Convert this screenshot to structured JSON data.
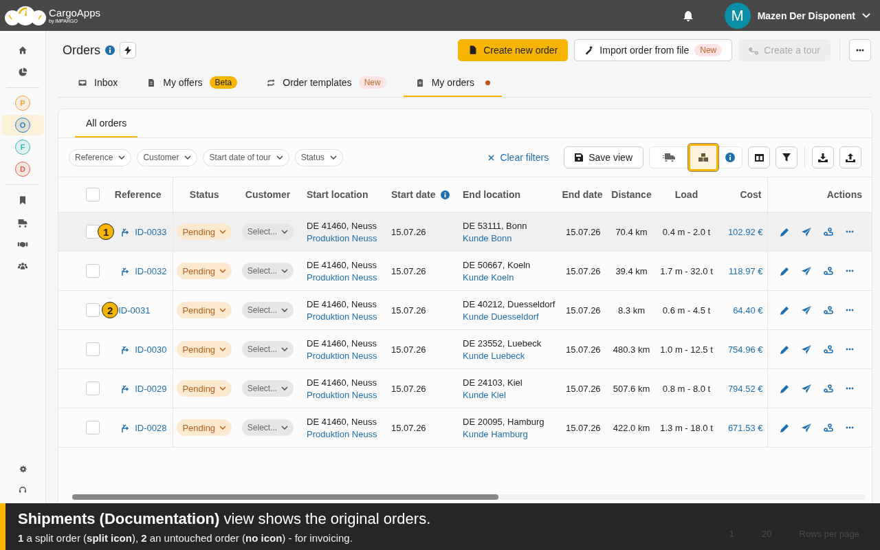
{
  "app": {
    "name": "CargoApps",
    "byline": "by IMPARGO"
  },
  "user": {
    "initial": "M",
    "name": "Mazen Der Disponent"
  },
  "sidebar": {
    "top": [
      {
        "kind": "home"
      },
      {
        "kind": "pie"
      }
    ],
    "letters": [
      {
        "letter": "P",
        "color": "#f0a53a",
        "selected": false
      },
      {
        "letter": "O",
        "color": "#2f80c0",
        "selected": true
      },
      {
        "letter": "F",
        "color": "#35b8b8",
        "selected": false
      },
      {
        "letter": "D",
        "color": "#e0674a",
        "selected": false
      }
    ],
    "middle": [
      {
        "kind": "bookmark"
      },
      {
        "kind": "truck"
      },
      {
        "kind": "handshake"
      },
      {
        "kind": "people"
      }
    ],
    "bottom": [
      {
        "kind": "gear"
      },
      {
        "kind": "headset"
      }
    ]
  },
  "page": {
    "title": "Orders"
  },
  "actions": [
    {
      "label": "Create new order",
      "kind": "primary",
      "disabled": false
    },
    {
      "label": "Import order from file",
      "kind": "import",
      "badge": "New",
      "disabled": false
    },
    {
      "label": "Create a tour",
      "kind": "tour",
      "disabled": true
    }
  ],
  "tabs": [
    {
      "label": "Inbox",
      "kind": "inbox",
      "selected": false
    },
    {
      "label": "My offers",
      "kind": "offers",
      "badge": "Beta",
      "selected": false
    },
    {
      "label": "Order templates",
      "kind": "templates",
      "badge": "New",
      "selected": false
    },
    {
      "label": "My orders",
      "kind": "orders",
      "dot": true,
      "selected": true
    }
  ],
  "subtabs": [
    {
      "label": "All orders",
      "selected": true
    }
  ],
  "filters": [
    "Reference",
    "Customer",
    "Start date of tour",
    "Status"
  ],
  "toolbar": {
    "clear": "Clear filters",
    "save": "Save view",
    "views": [
      {
        "kind": "truck",
        "selected": false
      },
      {
        "kind": "boxes",
        "selected": true
      }
    ]
  },
  "table": {
    "select_all_checked": false,
    "columns": [
      "Reference",
      "Status",
      "Customer",
      "Start location",
      "Start date",
      "End location",
      "End date",
      "Distance",
      "Load",
      "Cost",
      "Actions"
    ],
    "rows": [
      {
        "marker": "1",
        "split": true,
        "highlighted": true,
        "reference": "ID-0033",
        "status": "Pending",
        "customer": "Select...",
        "start": "DE 41460, Neuss",
        "start_site": "Produktion Neuss",
        "start_date": "15.07.26",
        "end": "DE 53111, Bonn",
        "end_site": "Kunde Bonn",
        "end_date": "15.07.26",
        "distance": "70.4 km",
        "load": "0.4 m - 2.0 t",
        "cost": "102.92 €"
      },
      {
        "split": true,
        "highlighted": false,
        "reference": "ID-0032",
        "status": "Pending",
        "customer": "Select...",
        "start": "DE 41460, Neuss",
        "start_site": "Produktion Neuss",
        "start_date": "15.07.26",
        "end": "DE 50667, Koeln",
        "end_site": "Kunde Koeln",
        "end_date": "15.07.26",
        "distance": "39.4 km",
        "load": "1.7 m - 32.0 t",
        "cost": "118.97 €"
      },
      {
        "marker": "2",
        "split": false,
        "highlighted": false,
        "reference": "ID-0031",
        "status": "Pending",
        "customer": "Select...",
        "start": "DE 41460, Neuss",
        "start_site": "Produktion Neuss",
        "start_date": "15.07.26",
        "end": "DE 40212, Duesseldorf",
        "end_site": "Kunde Duesseldorf",
        "end_date": "15.07.26",
        "distance": "8.3 km",
        "load": "0.6 m - 4.5 t",
        "cost": "64.40 €"
      },
      {
        "split": true,
        "highlighted": false,
        "reference": "ID-0030",
        "status": "Pending",
        "customer": "Select...",
        "start": "DE 41460, Neuss",
        "start_site": "Produktion Neuss",
        "start_date": "15.07.26",
        "end": "DE 23552, Luebeck",
        "end_site": "Kunde Luebeck",
        "end_date": "15.07.26",
        "distance": "480.3 km",
        "load": "1.0 m - 12.5 t",
        "cost": "754.96 €"
      },
      {
        "split": true,
        "highlighted": false,
        "reference": "ID-0029",
        "status": "Pending",
        "customer": "Select...",
        "start": "DE 41460, Neuss",
        "start_site": "Produktion Neuss",
        "start_date": "15.07.26",
        "end": "DE 24103, Kiel",
        "end_site": "Kunde Kiel",
        "end_date": "15.07.26",
        "distance": "507.6 km",
        "load": "0.8 m - 8.0 t",
        "cost": "794.52 €"
      },
      {
        "split": true,
        "highlighted": false,
        "reference": "ID-0028",
        "status": "Pending",
        "customer": "Select...",
        "start": "DE 41460, Neuss",
        "start_site": "Produktion Neuss",
        "start_date": "15.07.26",
        "end": "DE 20095, Hamburg",
        "end_site": "Kunde Hamburg",
        "end_date": "15.07.26",
        "distance": "422.0 km",
        "load": "1.3 m - 18.0 t",
        "cost": "671.53 €"
      }
    ]
  },
  "pagination": {
    "page": "1",
    "page_size": "20",
    "label": "Rows per page"
  },
  "caption": {
    "headline": "**Shipments (Documentation)** view shows the original orders.",
    "note": "**1** a split order (**split icon**), **2** an untouched order (**no icon**) - for invoicing."
  }
}
